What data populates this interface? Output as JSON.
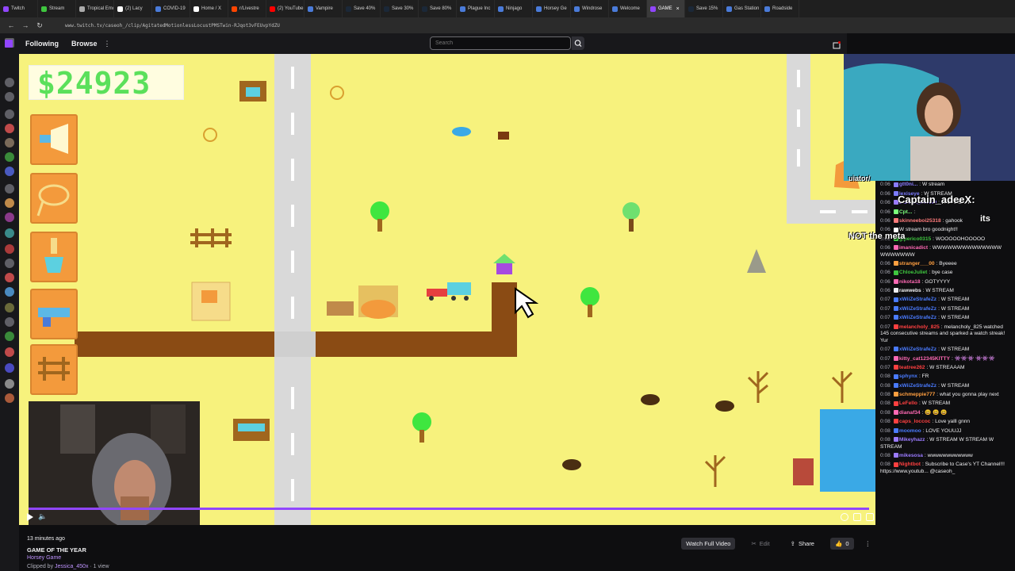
{
  "tabs": [
    {
      "label": "Twitch",
      "color": "#9146ff"
    },
    {
      "label": "Stream",
      "color": "#3fc63f"
    },
    {
      "label": "Tropical Emoji",
      "color": "#aaaaaa"
    },
    {
      "label": "(2) Lacy",
      "color": "#ffffff"
    },
    {
      "label": "COVID-19",
      "color": "#4a7bd9"
    },
    {
      "label": "Home / X",
      "color": "#ffffff"
    },
    {
      "label": "r/Livestre",
      "color": "#ff4500"
    },
    {
      "label": "(2) YouTube",
      "color": "#ff0000"
    },
    {
      "label": "Vampire",
      "color": "#4a7bd9"
    },
    {
      "label": "Save 40%",
      "color": "#1b2838"
    },
    {
      "label": "Save 30%",
      "color": "#1b2838"
    },
    {
      "label": "Save 80%",
      "color": "#1b2838"
    },
    {
      "label": "Plague Inc",
      "color": "#4a7bd9"
    },
    {
      "label": "Ninjago",
      "color": "#4a7bd9"
    },
    {
      "label": "Horsey Ge",
      "color": "#4a7bd9"
    },
    {
      "label": "Windrose",
      "color": "#4a7bd9"
    },
    {
      "label": "Welcome",
      "color": "#4a7bd9"
    },
    {
      "label": "GAME",
      "color": "#9146ff",
      "active": true
    },
    {
      "label": "Save 15%",
      "color": "#1b2838"
    },
    {
      "label": "Gas Station",
      "color": "#4a7bd9"
    },
    {
      "label": "Roadside",
      "color": "#4a7bd9"
    }
  ],
  "address": {
    "url": "www.twitch.tv/caseoh_/clip/AgitatedMotionlessLocustPMSTwin-RJqot3vFEUvpYdZU"
  },
  "nav": {
    "following": "Following",
    "browse": "Browse",
    "more": "⋮",
    "search_placeholder": "Search"
  },
  "game": {
    "money": "$24923"
  },
  "overlay": {
    "line1": "uiator/",
    "line2": "Captain_adeeX:",
    "line3": "its",
    "line4": "NOT the meta"
  },
  "chat": [
    {
      "time": "0:06",
      "user": "gtt0ni...",
      "color": "#8a7bff",
      "text": "W stream"
    },
    {
      "time": "0:06",
      "user": "lexiseye",
      "color": "#7b7bff",
      "text": "W STREAM"
    },
    {
      "time": "0:06",
      "user": "banana_milk99",
      "color": "#9b7bff",
      "text": "W STREAM"
    },
    {
      "time": "0:06",
      "user": "Cpt...",
      "color": "#7bff7b",
      "text": ""
    },
    {
      "time": "0:06",
      "user": "skinneeboi25318",
      "color": "#ff7b7b",
      "text": "gahook"
    },
    {
      "time": "0:06",
      "user": "",
      "color": "#ffffff",
      "text": "W stream bro goodnight!!"
    },
    {
      "time": "0:06",
      "user": "glperico0315",
      "color": "#3fc63f",
      "text": "WOOOOOHOOOOO"
    },
    {
      "time": "0:06",
      "user": "imanicadict",
      "color": "#ff69b4",
      "text": "WWWWWWWWWWWWWW WWWWWWW"
    },
    {
      "time": "0:06",
      "user": "stranger___00",
      "color": "#ff9f40",
      "text": "Byeeee"
    },
    {
      "time": "0:06",
      "user": "ChloeJuliet",
      "color": "#3fc63f",
      "text": "bye case"
    },
    {
      "time": "0:06",
      "user": "nikota18",
      "color": "#ff69b4",
      "text": "GOTYYYY"
    },
    {
      "time": "0:06",
      "user": "rawwebs",
      "color": "#efeff1",
      "text": "W STREAM"
    },
    {
      "time": "0:07",
      "user": "xWiiZeStrafeZz",
      "color": "#4a7bff",
      "text": "W STREAM"
    },
    {
      "time": "0:07",
      "user": "xWiiZeStrafeZz",
      "color": "#4a7bff",
      "text": "W STREAM"
    },
    {
      "time": "0:07",
      "user": "xWiiZeStrafeZz",
      "color": "#4a7bff",
      "text": "W STREAM"
    },
    {
      "time": "0:07",
      "user": "melancholy_825",
      "color": "#ff4040",
      "text": "melancholy_825 watched 145 consecutive streams and sparked a watch streak! Yur"
    },
    {
      "time": "0:07",
      "user": "xWiiZeStrafeZz",
      "color": "#4a7bff",
      "text": "W STREAM"
    },
    {
      "time": "0:07",
      "user": "kitty_cat12345KITTY",
      "color": "#ff69b4",
      "text": "👾👾👾 👾👾👾"
    },
    {
      "time": "0:07",
      "user": "teatree262",
      "color": "#ff4040",
      "text": "W STREAAAM"
    },
    {
      "time": "0:08",
      "user": "sphynx",
      "color": "#4a7bff",
      "text": "FR"
    },
    {
      "time": "0:08",
      "user": "xWiiZeStrafeZz",
      "color": "#4a7bff",
      "text": "W STREAM"
    },
    {
      "time": "0:08",
      "user": "schmeppie777",
      "color": "#ff9f40",
      "text": "what you gonna play next"
    },
    {
      "time": "0:08",
      "user": "LeFello",
      "color": "#ff4040",
      "text": "W STREAM"
    },
    {
      "time": "0:08",
      "user": "dianaf34",
      "color": "#ff69b4",
      "text": "😃 😃 😃"
    },
    {
      "time": "0:08",
      "user": "caps_loccoc",
      "color": "#ff4040",
      "text": "Love yalll gnnn"
    },
    {
      "time": "0:08",
      "user": "moomoo",
      "color": "#4a7bff",
      "text": "LOVE YOUUJJ"
    },
    {
      "time": "0:08",
      "user": "Mikeyhazz",
      "color": "#9b7bff",
      "text": "W STREAM W STREAM W STREAM"
    },
    {
      "time": "0:08",
      "user": "mikesosa",
      "color": "#9b7bff",
      "text": "wwwwwwwwwwww"
    },
    {
      "time": "0:08",
      "user": "Nightbot",
      "color": "#ff4040",
      "text": "Subscribe to Case's YT Channel!!! https://www.youtub... @caseoh_"
    }
  ],
  "clip": {
    "time_ago": "13 minutes ago",
    "title": "GAME OF THE YEAR",
    "game": "Horsey Game",
    "clipped_prefix": "Clipped by ",
    "clipper": "Jessica_450x",
    "views": " · 1 view"
  },
  "actions": {
    "watch_full": "Watch Full Video",
    "edit": "Edit",
    "share": "Share",
    "likes": "0",
    "more": "⋮"
  },
  "colors": {
    "twitch_purple": "#9146ff",
    "grass": "#f7f27d",
    "road": "#d9d9d9",
    "dirt": "#8a4b14",
    "tool": "#f39a3c"
  },
  "icons": [
    "play-icon",
    "volume-icon",
    "settings-icon",
    "theater-icon",
    "fullscreen-icon",
    "search-icon",
    "share-icon",
    "like-icon",
    "scissors-icon"
  ]
}
